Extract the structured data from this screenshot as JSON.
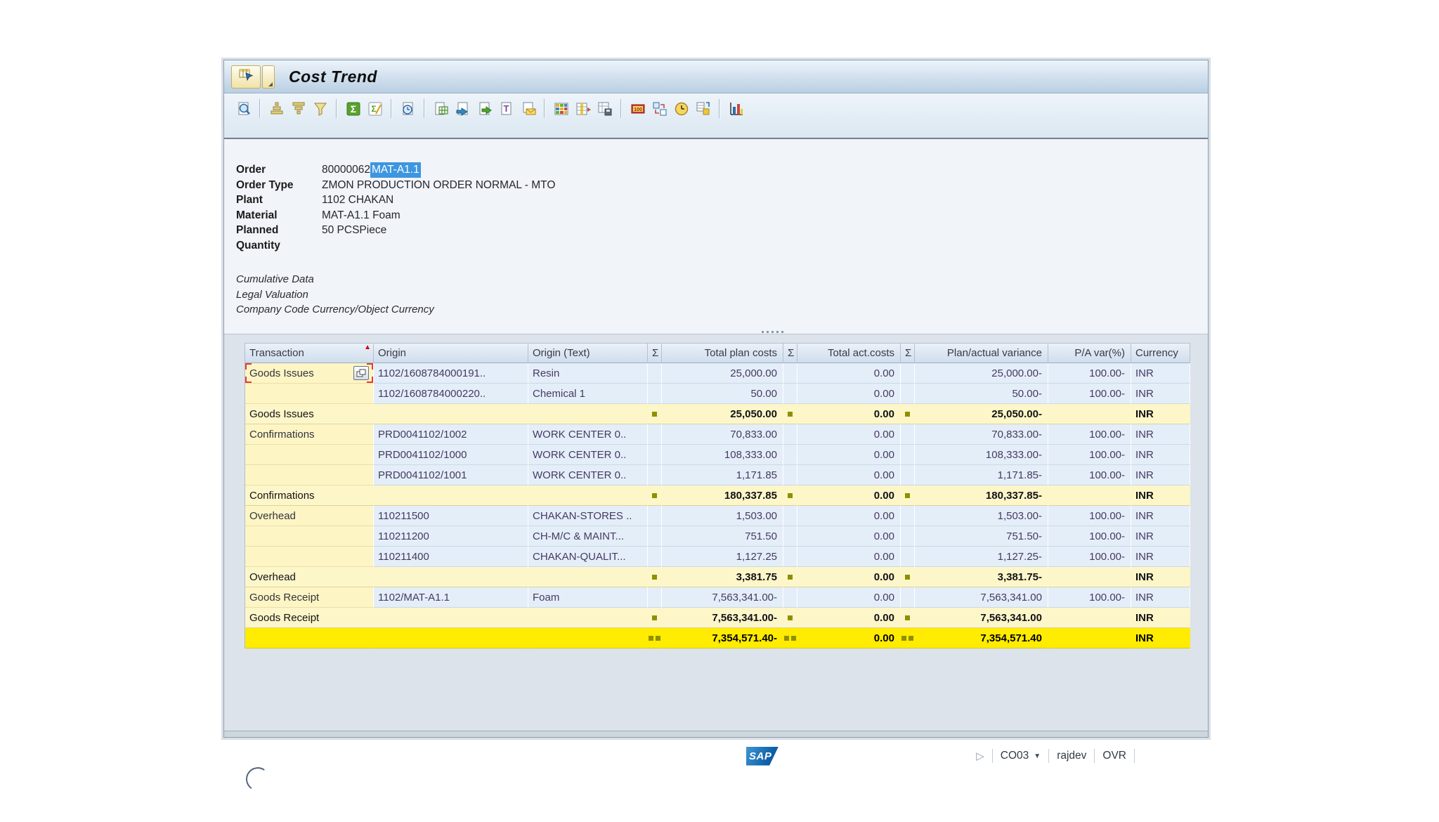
{
  "titlebar": {
    "title": "Cost Trend",
    "menu_icon": "alv-layout-menu-icon",
    "menu_dropdown_icon": "dropdown-corner-icon"
  },
  "toolbar": {
    "groups": [
      [
        "details"
      ],
      [
        "sort-ascending",
        "sort-descending",
        "filter"
      ],
      [
        "sum",
        "subtotal"
      ],
      [
        "print-preview"
      ],
      [
        "export-spreadsheet",
        "word-processing",
        "export-local-file",
        "abc-analysis",
        "send-mail"
      ],
      [
        "choose-layout",
        "change-layout",
        "save-layout"
      ],
      [
        "display-currency",
        "units-conversion",
        "time",
        "layout-graphic"
      ],
      [
        "graphics-chart"
      ]
    ]
  },
  "order_header": {
    "fields": [
      {
        "label": "Order",
        "value": "80000062",
        "highlight": "MAT-A1.1"
      },
      {
        "label": "Order Type",
        "value": "ZMON PRODUCTION ORDER NORMAL - MTO"
      },
      {
        "label": "Plant",
        "value": "1102 CHAKAN"
      },
      {
        "label": "Material",
        "value": "MAT-A1.1 Foam"
      },
      {
        "label": "Planned Quantity",
        "value": "50 PCSPiece"
      }
    ],
    "notes": [
      "Cumulative Data",
      "Legal Valuation",
      "Company Code Currency/Object Currency"
    ]
  },
  "table": {
    "columns": [
      {
        "label": "Transaction",
        "sorted_ascending": true
      },
      {
        "label": "Origin"
      },
      {
        "label": "Origin (Text)"
      },
      {
        "label": "Σ"
      },
      {
        "label": "Total plan costs"
      },
      {
        "label": "Σ"
      },
      {
        "label": "Total act.costs"
      },
      {
        "label": "Σ"
      },
      {
        "label": "Plan/actual variance"
      },
      {
        "label": "P/A var(%)"
      },
      {
        "label": "Currency"
      }
    ],
    "rows": [
      {
        "type": "data",
        "selected": true,
        "transaction": "Goods Issues",
        "origin": "1102/1608784000191..",
        "origin_text": "Resin",
        "total_plan_costs": "25,000.00",
        "total_act_costs": "0.00",
        "plan_actual_variance": "25,000.00-",
        "pa_var_pct": "100.00-",
        "currency": "INR"
      },
      {
        "type": "data",
        "transaction": "",
        "origin": "1102/1608784000220..",
        "origin_text": "Chemical 1",
        "total_plan_costs": "50.00",
        "total_act_costs": "0.00",
        "plan_actual_variance": "50.00-",
        "pa_var_pct": "100.00-",
        "currency": "INR"
      },
      {
        "type": "subtotal",
        "transaction": "Goods Issues",
        "origin": "",
        "origin_text": "",
        "total_plan_costs": "25,050.00",
        "total_act_costs": "0.00",
        "plan_actual_variance": "25,050.00-",
        "pa_var_pct": "",
        "currency": "INR"
      },
      {
        "type": "data",
        "transaction": "Confirmations",
        "origin": "PRD0041102/1002",
        "origin_text": "WORK CENTER 0..",
        "total_plan_costs": "70,833.00",
        "total_act_costs": "0.00",
        "plan_actual_variance": "70,833.00-",
        "pa_var_pct": "100.00-",
        "currency": "INR"
      },
      {
        "type": "data",
        "transaction": "",
        "origin": "PRD0041102/1000",
        "origin_text": "WORK CENTER 0..",
        "total_plan_costs": "108,333.00",
        "total_act_costs": "0.00",
        "plan_actual_variance": "108,333.00-",
        "pa_var_pct": "100.00-",
        "currency": "INR"
      },
      {
        "type": "data",
        "transaction": "",
        "origin": "PRD0041102/1001",
        "origin_text": "WORK CENTER 0..",
        "total_plan_costs": "1,171.85",
        "total_act_costs": "0.00",
        "plan_actual_variance": "1,171.85-",
        "pa_var_pct": "100.00-",
        "currency": "INR"
      },
      {
        "type": "subtotal",
        "transaction": "Confirmations",
        "origin": "",
        "origin_text": "",
        "total_plan_costs": "180,337.85",
        "total_act_costs": "0.00",
        "plan_actual_variance": "180,337.85-",
        "pa_var_pct": "",
        "currency": "INR"
      },
      {
        "type": "data",
        "transaction": "Overhead",
        "origin": "110211500",
        "origin_text": "CHAKAN-STORES ..",
        "total_plan_costs": "1,503.00",
        "total_act_costs": "0.00",
        "plan_actual_variance": "1,503.00-",
        "pa_var_pct": "100.00-",
        "currency": "INR"
      },
      {
        "type": "data",
        "transaction": "",
        "origin": "110211200",
        "origin_text": "CH-M/C & MAINT...",
        "total_plan_costs": "751.50",
        "total_act_costs": "0.00",
        "plan_actual_variance": "751.50-",
        "pa_var_pct": "100.00-",
        "currency": "INR"
      },
      {
        "type": "data",
        "transaction": "",
        "origin": "110211400",
        "origin_text": "CHAKAN-QUALIT...",
        "total_plan_costs": "1,127.25",
        "total_act_costs": "0.00",
        "plan_actual_variance": "1,127.25-",
        "pa_var_pct": "100.00-",
        "currency": "INR"
      },
      {
        "type": "subtotal",
        "transaction": "Overhead",
        "origin": "",
        "origin_text": "",
        "total_plan_costs": "3,381.75",
        "total_act_costs": "0.00",
        "plan_actual_variance": "3,381.75-",
        "pa_var_pct": "",
        "currency": "INR"
      },
      {
        "type": "data",
        "transaction": "Goods Receipt",
        "origin": "1102/MAT-A1.1",
        "origin_text": "Foam",
        "total_plan_costs": "7,563,341.00-",
        "total_act_costs": "0.00",
        "plan_actual_variance": "7,563,341.00",
        "pa_var_pct": "100.00-",
        "currency": "INR"
      },
      {
        "type": "subtotal",
        "transaction": "Goods Receipt",
        "origin": "",
        "origin_text": "",
        "total_plan_costs": "7,563,341.00-",
        "total_act_costs": "0.00",
        "plan_actual_variance": "7,563,341.00",
        "pa_var_pct": "",
        "currency": "INR"
      },
      {
        "type": "grandtotal",
        "transaction": "",
        "origin": "",
        "origin_text": "",
        "total_plan_costs": "7,354,571.40-",
        "total_act_costs": "0.00",
        "plan_actual_variance": "7,354,571.40",
        "pa_var_pct": "",
        "currency": "INR"
      }
    ]
  },
  "statusbar": {
    "sap_logo": "SAP",
    "expand_icon": "expand-triangle-icon",
    "transaction_code": "CO03",
    "user": "rajdev",
    "mode": "OVR"
  },
  "colors": {
    "selection_highlight": "#3d96e0",
    "group_yellow": "#fdf5c4",
    "subtotal_yellow": "#fdf6c9",
    "grand_total_yellow": "#ffec00",
    "subtotal_marker": "#8f8f00",
    "sort_arrow_red": "#d30000",
    "cell_selection_red": "#e8392e"
  }
}
